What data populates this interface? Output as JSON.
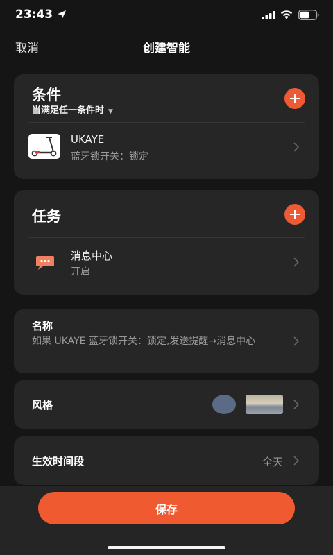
{
  "status_bar": {
    "time": "23:43"
  },
  "nav": {
    "cancel_label": "取消",
    "title": "创建智能"
  },
  "conditions": {
    "title": "条件",
    "mode": "当满足任一条件时",
    "item": {
      "name": "UKAYE",
      "detail": "蓝牙锁开关：锁定"
    }
  },
  "tasks": {
    "title": "任务",
    "item": {
      "name": "消息中心",
      "detail": "开启"
    }
  },
  "name_section": {
    "label": "名称",
    "value": "如果 UKAYE 蓝牙锁开关：锁定,发送提醒→消息中心"
  },
  "style_section": {
    "label": "风格",
    "swatch_color": "#5b6b85"
  },
  "period_section": {
    "label": "生效时间段",
    "value": "全天"
  },
  "save_label": "保存",
  "colors": {
    "accent": "#ef5a30",
    "card": "#262626",
    "background": "#151515"
  }
}
